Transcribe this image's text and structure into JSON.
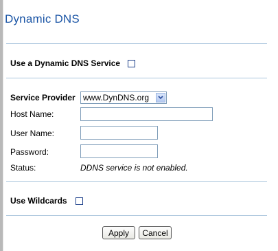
{
  "page": {
    "title": "Dynamic DNS"
  },
  "ddns": {
    "use_label": "Use a Dynamic DNS Service"
  },
  "provider": {
    "label": "Service Provider",
    "selected": "www.DynDNS.org"
  },
  "fields": {
    "host_label": "Host Name:",
    "host_value": "",
    "user_label": "User Name:",
    "user_value": "",
    "password_label": "Password:",
    "password_value": ""
  },
  "status": {
    "label": "Status:",
    "value": "DDNS service is not enabled."
  },
  "wildcards": {
    "label": "Use Wildcards"
  },
  "buttons": {
    "apply": "Apply",
    "cancel": "Cancel"
  },
  "colors": {
    "title": "#1c56a6",
    "rule": "#a8c4dc"
  }
}
